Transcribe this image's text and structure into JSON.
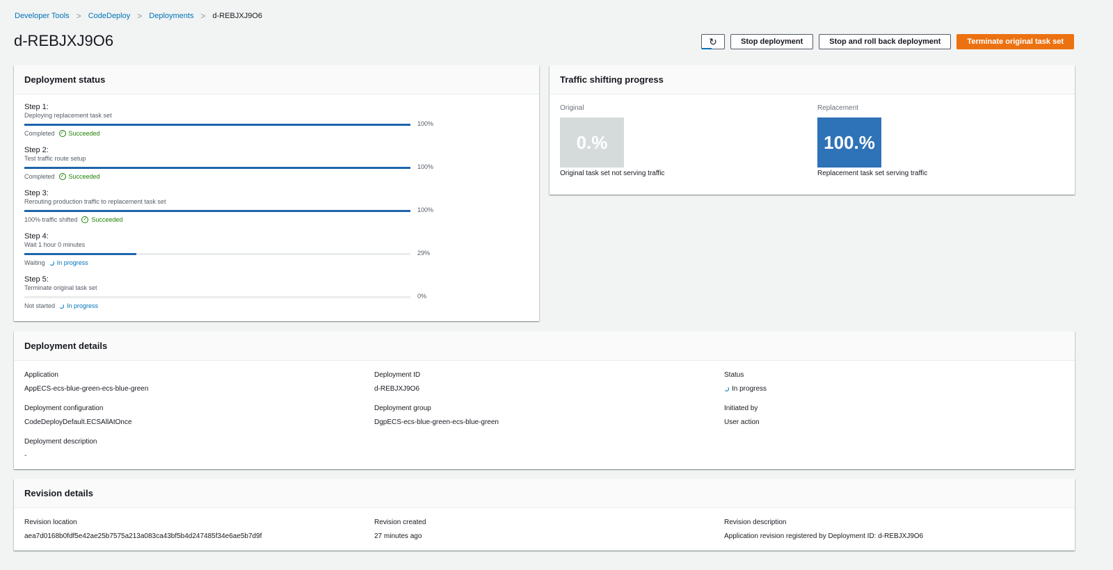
{
  "breadcrumb": [
    "Developer Tools",
    "CodeDeploy",
    "Deployments",
    "d-REBJXJ9O6"
  ],
  "title": "d-REBJXJ9O6",
  "actions": {
    "refresh_icon": "refresh-icon",
    "stop": "Stop deployment",
    "rollback": "Stop and roll back deployment",
    "terminate": "Terminate original task set"
  },
  "status_panel": {
    "title": "Deployment status",
    "steps": [
      {
        "label": "Step 1:",
        "desc": "Deploying replacement task set",
        "percent": 100,
        "percent_label": "100%",
        "state": "Completed",
        "badge": "Succeeded",
        "badge_type": "success"
      },
      {
        "label": "Step 2:",
        "desc": "Test traffic route setup",
        "percent": 100,
        "percent_label": "100%",
        "state": "Completed",
        "badge": "Succeeded",
        "badge_type": "success"
      },
      {
        "label": "Step 3:",
        "desc": "Rerouting production traffic to replacement task set",
        "percent": 100,
        "percent_label": "100%",
        "state": "100% traffic shifted",
        "badge": "Succeeded",
        "badge_type": "success"
      },
      {
        "label": "Step 4:",
        "desc": "Wait 1 hour 0 minutes",
        "percent": 29,
        "percent_label": "29%",
        "state": "Waiting",
        "badge": "In progress",
        "badge_type": "progress"
      },
      {
        "label": "Step 5:",
        "desc": "Terminate original task set",
        "percent": 0,
        "percent_label": "0%",
        "state": "Not started",
        "badge": "In progress",
        "badge_type": "progress"
      }
    ]
  },
  "traffic": {
    "title": "Traffic shifting progress",
    "original": {
      "label": "Original",
      "value": "0.%",
      "caption": "Original task set not serving traffic",
      "color": "#d5dbdb"
    },
    "replacement": {
      "label": "Replacement",
      "value": "100.%",
      "caption": "Replacement task set serving traffic",
      "color": "#2e73b8"
    }
  },
  "details": {
    "title": "Deployment details",
    "application_label": "Application",
    "application": "AppECS-ecs-blue-green-ecs-blue-green",
    "id_label": "Deployment ID",
    "id": "d-REBJXJ9O6",
    "status_label": "Status",
    "status": "In progress",
    "config_label": "Deployment configuration",
    "config": "CodeDeployDefault.ECSAllAtOnce",
    "group_label": "Deployment group",
    "group": "DgpECS-ecs-blue-green-ecs-blue-green",
    "initiated_label": "Initiated by",
    "initiated": "User action",
    "description_label": "Deployment description",
    "description": "-"
  },
  "revision": {
    "title": "Revision details",
    "location_label": "Revision location",
    "location": "aea7d0168b0fdf5e42ae25b7575a213a083ca43bf5b4d247485f34e6ae5b7d9f",
    "created_label": "Revision created",
    "created": "27 minutes ago",
    "description_label": "Revision description",
    "description": "Application revision registered by Deployment ID: d-REBJXJ9O6"
  }
}
